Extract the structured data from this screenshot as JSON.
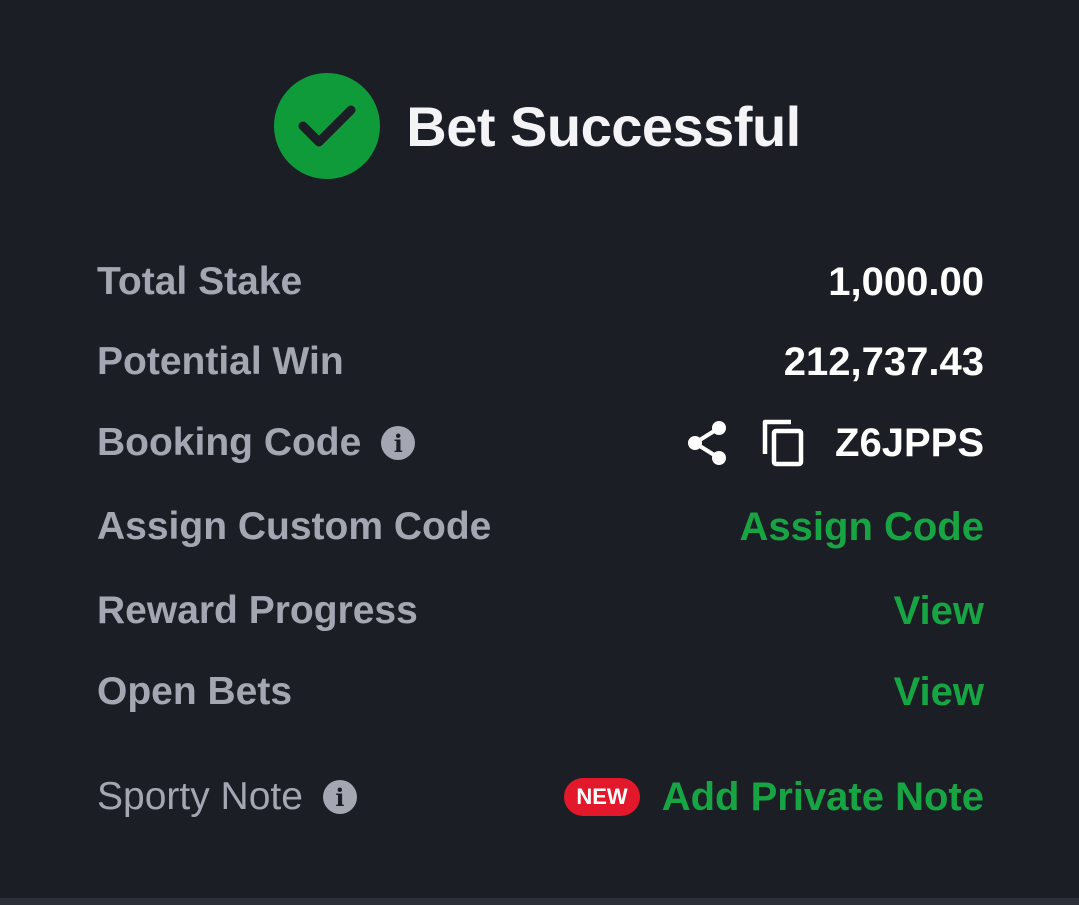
{
  "header": {
    "icon": "check-circle-icon",
    "title": "Bet Successful"
  },
  "rows": {
    "total_stake": {
      "label": "Total Stake",
      "value": "1,000.00"
    },
    "potential_win": {
      "label": "Potential Win",
      "value": "212,737.43"
    },
    "booking_code": {
      "label": "Booking Code",
      "info_icon": "info-icon",
      "share_icon": "share-icon",
      "copy_icon": "copy-icon",
      "value": "Z6JPPS"
    },
    "assign_custom_code": {
      "label": "Assign Custom Code",
      "action": "Assign Code"
    },
    "reward_progress": {
      "label": "Reward Progress",
      "action": "View"
    },
    "open_bets": {
      "label": "Open Bets",
      "action": "View"
    },
    "sporty_note": {
      "label": "Sporty Note",
      "info_icon": "info-icon",
      "badge": "NEW",
      "action": "Add Private Note"
    }
  },
  "colors": {
    "background": "#1c1e26",
    "success_green": "#0f9b3a",
    "link_green": "#17a543",
    "label_gray": "#a4a7b2",
    "badge_red": "#e3192b"
  }
}
